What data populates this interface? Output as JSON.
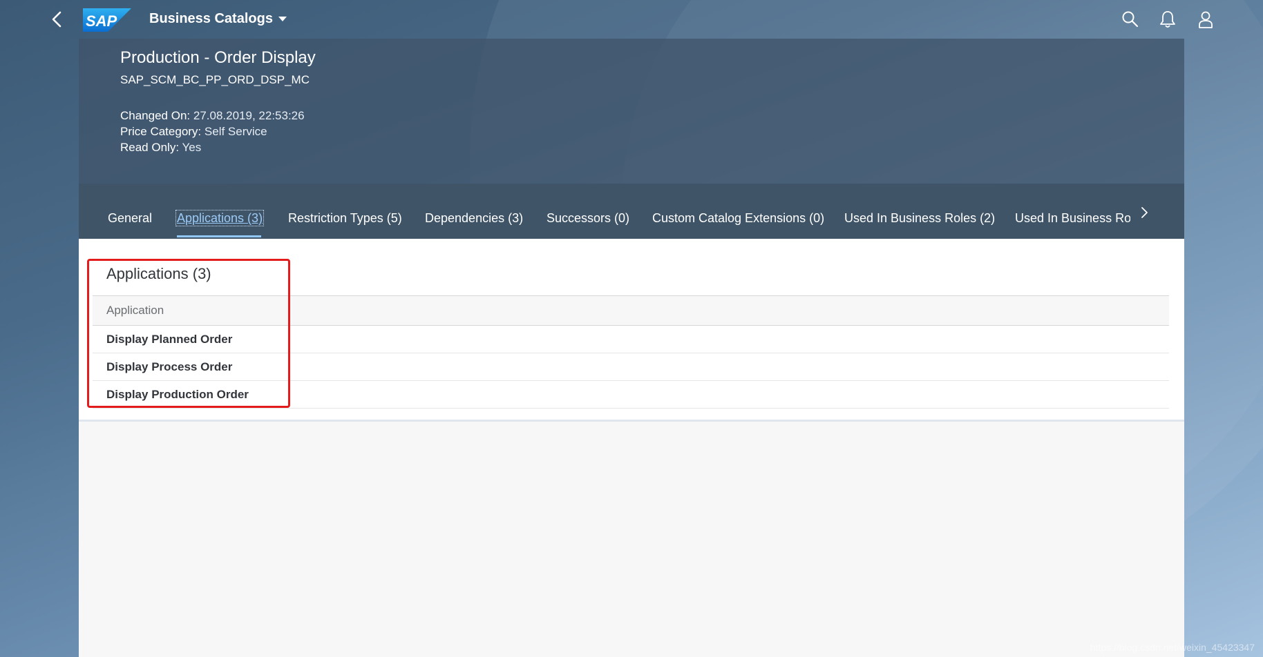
{
  "shell": {
    "app_title": "Business Catalogs",
    "logo_text": "SAP",
    "icons": [
      "back-icon",
      "search-icon",
      "bell-icon",
      "user-icon"
    ]
  },
  "header": {
    "title": "Production - Order Display",
    "subtitle": "SAP_SCM_BC_PP_ORD_DSP_MC",
    "attributes": [
      {
        "label": "Changed On:",
        "value": "27.08.2019, 22:53:26"
      },
      {
        "label": "Price Category:",
        "value": "Self Service"
      },
      {
        "label": "Read Only:",
        "value": "Yes"
      }
    ]
  },
  "tabs": [
    {
      "label": "General"
    },
    {
      "label": "Applications (3)"
    },
    {
      "label": "Restriction Types (5)"
    },
    {
      "label": "Dependencies (3)"
    },
    {
      "label": "Successors (0)"
    },
    {
      "label": "Custom Catalog Extensions (0)"
    },
    {
      "label": "Used In Business Roles (2)"
    },
    {
      "label": "Used In Business Role"
    }
  ],
  "active_tab": "Applications (3)",
  "applications": {
    "title": "Applications (3)",
    "column_header": "Application",
    "rows": [
      "Display Planned Order",
      "Display Process Order",
      "Display Production Order"
    ]
  },
  "watermark": "https://blog.csdn.net/weixin_45423347",
  "colors": {
    "highlight": "#e31b1b",
    "active_tab": "#9ccaf7",
    "header_bg": "#40556c"
  }
}
